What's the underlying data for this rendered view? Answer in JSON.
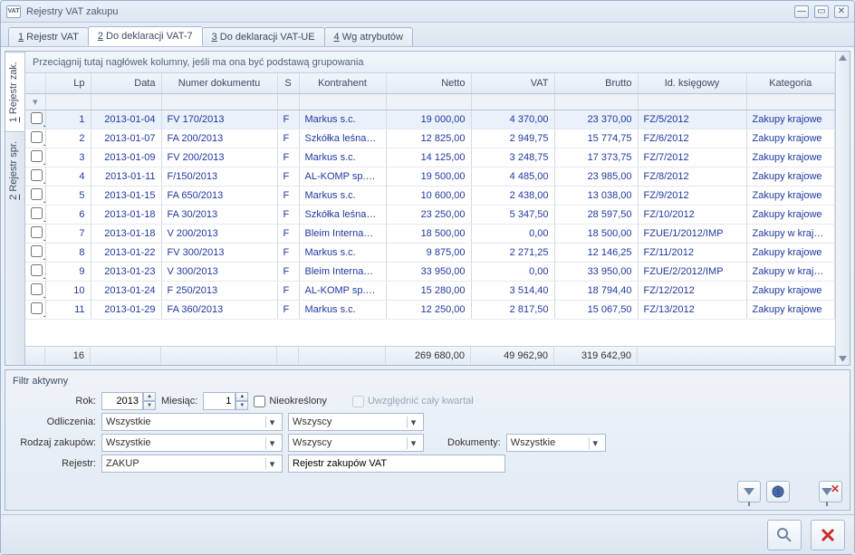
{
  "window": {
    "title": "Rejestry VAT zakupu"
  },
  "top_tabs": [
    {
      "accel": "1",
      "label": " Rejestr VAT"
    },
    {
      "accel": "2",
      "label": " Do deklaracji VAT-7"
    },
    {
      "accel": "3",
      "label": " Do deklaracji VAT-UE"
    },
    {
      "accel": "4",
      "label": " Wg atrybutów"
    }
  ],
  "side_tabs": [
    {
      "accel": "1",
      "label": " Rejestr zak."
    },
    {
      "accel": "2",
      "label": " Rejestr spr."
    }
  ],
  "group_bar": "Przeciągnij tutaj nagłówek kolumny, jeśli ma ona być podstawą grupowania",
  "columns": {
    "lp": "Lp",
    "data": "Data",
    "doc": "Numer dokumentu",
    "s": "S",
    "kh": "Kontrahent",
    "netto": "Netto",
    "vat": "VAT",
    "brutto": "Brutto",
    "id": "Id. księgowy",
    "kat": "Kategoria"
  },
  "rows": [
    {
      "lp": "1",
      "data": "2013-01-04",
      "doc": "FV 170/2013",
      "s": "F",
      "kh": "Markus s.c.",
      "netto": "19 000,00",
      "vat": "4 370,00",
      "brutto": "23 370,00",
      "id": "FZ/5/2012",
      "kat": "Zakupy krajowe"
    },
    {
      "lp": "2",
      "data": "2013-01-07",
      "doc": "FA 200/2013",
      "s": "F",
      "kh": "Szkółka leśna…",
      "netto": "12 825,00",
      "vat": "2 949,75",
      "brutto": "15 774,75",
      "id": "FZ/6/2012",
      "kat": "Zakupy krajowe"
    },
    {
      "lp": "3",
      "data": "2013-01-09",
      "doc": "FV 200/2013",
      "s": "F",
      "kh": "Markus s.c.",
      "netto": "14 125,00",
      "vat": "3 248,75",
      "brutto": "17 373,75",
      "id": "FZ/7/2012",
      "kat": "Zakupy krajowe"
    },
    {
      "lp": "4",
      "data": "2013-01-11",
      "doc": "F/150/2013",
      "s": "F",
      "kh": "AL-KOMP sp.…",
      "netto": "19 500,00",
      "vat": "4 485,00",
      "brutto": "23 985,00",
      "id": "FZ/8/2012",
      "kat": "Zakupy krajowe"
    },
    {
      "lp": "5",
      "data": "2013-01-15",
      "doc": "FA 650/2013",
      "s": "F",
      "kh": "Markus s.c.",
      "netto": "10 600,00",
      "vat": "2 438,00",
      "brutto": "13 038,00",
      "id": "FZ/9/2012",
      "kat": "Zakupy krajowe"
    },
    {
      "lp": "6",
      "data": "2013-01-18",
      "doc": "FA 30/2013",
      "s": "F",
      "kh": "Szkółka leśna…",
      "netto": "23 250,00",
      "vat": "5 347,50",
      "brutto": "28 597,50",
      "id": "FZ/10/2012",
      "kat": "Zakupy krajowe"
    },
    {
      "lp": "7",
      "data": "2013-01-18",
      "doc": "V 200/2013",
      "s": "F",
      "kh": "Bleim Interna…",
      "netto": "18 500,00",
      "vat": "0,00",
      "brutto": "18 500,00",
      "id": "FZUE/1/2012/IMP",
      "kat": "Zakupy w krajach…"
    },
    {
      "lp": "8",
      "data": "2013-01-22",
      "doc": "FV 300/2013",
      "s": "F",
      "kh": "Markus s.c.",
      "netto": "9 875,00",
      "vat": "2 271,25",
      "brutto": "12 146,25",
      "id": "FZ/11/2012",
      "kat": "Zakupy krajowe"
    },
    {
      "lp": "9",
      "data": "2013-01-23",
      "doc": "V 300/2013",
      "s": "F",
      "kh": "Bleim Interna…",
      "netto": "33 950,00",
      "vat": "0,00",
      "brutto": "33 950,00",
      "id": "FZUE/2/2012/IMP",
      "kat": "Zakupy w krajach…"
    },
    {
      "lp": "10",
      "data": "2013-01-24",
      "doc": "F 250/2013",
      "s": "F",
      "kh": "AL-KOMP sp.…",
      "netto": "15 280,00",
      "vat": "3 514,40",
      "brutto": "18 794,40",
      "id": "FZ/12/2012",
      "kat": "Zakupy krajowe"
    },
    {
      "lp": "11",
      "data": "2013-01-29",
      "doc": "FA 360/2013",
      "s": "F",
      "kh": "Markus s.c.",
      "netto": "12 250,00",
      "vat": "2 817,50",
      "brutto": "15 067,50",
      "id": "FZ/13/2012",
      "kat": "Zakupy krajowe"
    }
  ],
  "totals": {
    "count": "16",
    "netto": "269 680,00",
    "vat": "49 962,90",
    "brutto": "319 642,90"
  },
  "filter": {
    "heading": "Filtr aktywny",
    "labels": {
      "rok": "Rok:",
      "miesiac": "Miesiąc:",
      "nieokreslony": "Nieokreślony",
      "kwartal": "Uwzględnić cały kwartał",
      "odliczenia": "Odliczenia:",
      "rodzaj": "Rodzaj zakupów:",
      "dokumenty": "Dokumenty:",
      "rejestr": "Rejestr:"
    },
    "values": {
      "rok": "2013",
      "miesiac": "1",
      "odliczenia": "Wszystkie",
      "odliczenia2": "Wszyscy",
      "rodzaj": "Wszystkie",
      "rodzaj2": "Wszyscy",
      "dokumenty": "Wszystkie",
      "rejestr": "ZAKUP",
      "rejestr_name": "Rejestr zakupów VAT"
    }
  }
}
